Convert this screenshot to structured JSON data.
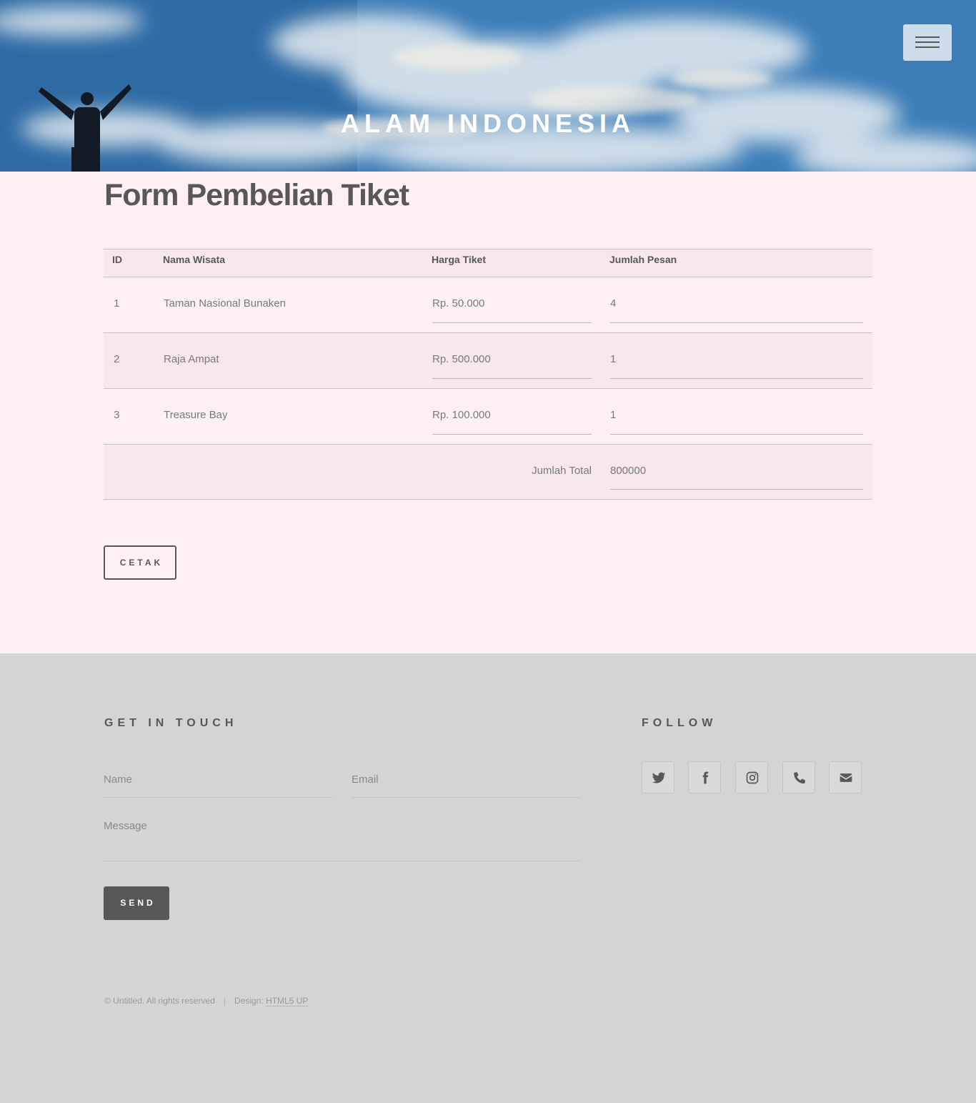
{
  "header": {
    "site_title": "ALAM INDONESIA",
    "menu_icon": "hamburger-menu-icon"
  },
  "main": {
    "title": "Form Pembelian Tiket",
    "table": {
      "headers": [
        "ID",
        "Nama Wisata",
        "Harga Tiket",
        "Jumlah Pesan"
      ],
      "rows": [
        {
          "id": "1",
          "name": "Taman Nasional Bunaken",
          "price": "Rp. 50.000",
          "qty": "4"
        },
        {
          "id": "2",
          "name": "Raja Ampat",
          "price": "Rp. 500.000",
          "qty": "1"
        },
        {
          "id": "3",
          "name": "Treasure Bay",
          "price": "Rp. 100.000",
          "qty": "1"
        }
      ],
      "total_label": "Jumlah Total",
      "total_value": "800000"
    },
    "print_button": "CETAK"
  },
  "footer": {
    "contact_heading": "GET IN TOUCH",
    "name_placeholder": "Name",
    "email_placeholder": "Email",
    "message_placeholder": "Message",
    "send_button": "SEND",
    "follow_heading": "FOLLOW",
    "social_icons": [
      "twitter-icon",
      "facebook-icon",
      "instagram-icon",
      "phone-icon",
      "envelope-icon"
    ],
    "copyright": "© Untitled. All rights reserved",
    "separator": "|",
    "design_label": "Design:",
    "design_link": "HTML5 UP"
  }
}
